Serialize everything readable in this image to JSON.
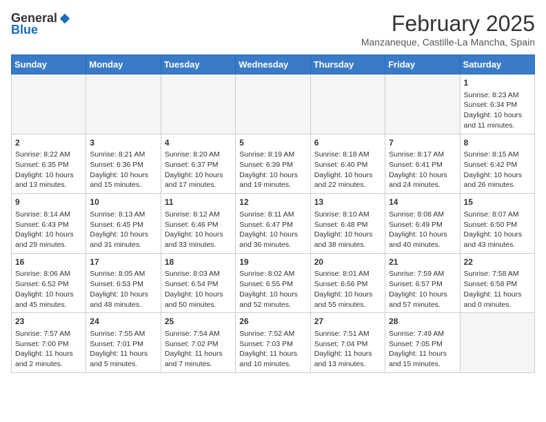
{
  "header": {
    "logo_general": "General",
    "logo_blue": "Blue",
    "month_year": "February 2025",
    "location": "Manzaneque, Castille-La Mancha, Spain"
  },
  "weekdays": [
    "Sunday",
    "Monday",
    "Tuesday",
    "Wednesday",
    "Thursday",
    "Friday",
    "Saturday"
  ],
  "weeks": [
    [
      {
        "day": "",
        "info": ""
      },
      {
        "day": "",
        "info": ""
      },
      {
        "day": "",
        "info": ""
      },
      {
        "day": "",
        "info": ""
      },
      {
        "day": "",
        "info": ""
      },
      {
        "day": "",
        "info": ""
      },
      {
        "day": "1",
        "info": "Sunrise: 8:23 AM\nSunset: 6:34 PM\nDaylight: 10 hours\nand 11 minutes."
      }
    ],
    [
      {
        "day": "2",
        "info": "Sunrise: 8:22 AM\nSunset: 6:35 PM\nDaylight: 10 hours\nand 13 minutes."
      },
      {
        "day": "3",
        "info": "Sunrise: 8:21 AM\nSunset: 6:36 PM\nDaylight: 10 hours\nand 15 minutes."
      },
      {
        "day": "4",
        "info": "Sunrise: 8:20 AM\nSunset: 6:37 PM\nDaylight: 10 hours\nand 17 minutes."
      },
      {
        "day": "5",
        "info": "Sunrise: 8:19 AM\nSunset: 6:39 PM\nDaylight: 10 hours\nand 19 minutes."
      },
      {
        "day": "6",
        "info": "Sunrise: 8:18 AM\nSunset: 6:40 PM\nDaylight: 10 hours\nand 22 minutes."
      },
      {
        "day": "7",
        "info": "Sunrise: 8:17 AM\nSunset: 6:41 PM\nDaylight: 10 hours\nand 24 minutes."
      },
      {
        "day": "8",
        "info": "Sunrise: 8:15 AM\nSunset: 6:42 PM\nDaylight: 10 hours\nand 26 minutes."
      }
    ],
    [
      {
        "day": "9",
        "info": "Sunrise: 8:14 AM\nSunset: 6:43 PM\nDaylight: 10 hours\nand 29 minutes."
      },
      {
        "day": "10",
        "info": "Sunrise: 8:13 AM\nSunset: 6:45 PM\nDaylight: 10 hours\nand 31 minutes."
      },
      {
        "day": "11",
        "info": "Sunrise: 8:12 AM\nSunset: 6:46 PM\nDaylight: 10 hours\nand 33 minutes."
      },
      {
        "day": "12",
        "info": "Sunrise: 8:11 AM\nSunset: 6:47 PM\nDaylight: 10 hours\nand 36 minutes."
      },
      {
        "day": "13",
        "info": "Sunrise: 8:10 AM\nSunset: 6:48 PM\nDaylight: 10 hours\nand 38 minutes."
      },
      {
        "day": "14",
        "info": "Sunrise: 8:08 AM\nSunset: 6:49 PM\nDaylight: 10 hours\nand 40 minutes."
      },
      {
        "day": "15",
        "info": "Sunrise: 8:07 AM\nSunset: 6:50 PM\nDaylight: 10 hours\nand 43 minutes."
      }
    ],
    [
      {
        "day": "16",
        "info": "Sunrise: 8:06 AM\nSunset: 6:52 PM\nDaylight: 10 hours\nand 45 minutes."
      },
      {
        "day": "17",
        "info": "Sunrise: 8:05 AM\nSunset: 6:53 PM\nDaylight: 10 hours\nand 48 minutes."
      },
      {
        "day": "18",
        "info": "Sunrise: 8:03 AM\nSunset: 6:54 PM\nDaylight: 10 hours\nand 50 minutes."
      },
      {
        "day": "19",
        "info": "Sunrise: 8:02 AM\nSunset: 6:55 PM\nDaylight: 10 hours\nand 52 minutes."
      },
      {
        "day": "20",
        "info": "Sunrise: 8:01 AM\nSunset: 6:56 PM\nDaylight: 10 hours\nand 55 minutes."
      },
      {
        "day": "21",
        "info": "Sunrise: 7:59 AM\nSunset: 6:57 PM\nDaylight: 10 hours\nand 57 minutes."
      },
      {
        "day": "22",
        "info": "Sunrise: 7:58 AM\nSunset: 6:58 PM\nDaylight: 11 hours\nand 0 minutes."
      }
    ],
    [
      {
        "day": "23",
        "info": "Sunrise: 7:57 AM\nSunset: 7:00 PM\nDaylight: 11 hours\nand 2 minutes."
      },
      {
        "day": "24",
        "info": "Sunrise: 7:55 AM\nSunset: 7:01 PM\nDaylight: 11 hours\nand 5 minutes."
      },
      {
        "day": "25",
        "info": "Sunrise: 7:54 AM\nSunset: 7:02 PM\nDaylight: 11 hours\nand 7 minutes."
      },
      {
        "day": "26",
        "info": "Sunrise: 7:52 AM\nSunset: 7:03 PM\nDaylight: 11 hours\nand 10 minutes."
      },
      {
        "day": "27",
        "info": "Sunrise: 7:51 AM\nSunset: 7:04 PM\nDaylight: 11 hours\nand 13 minutes."
      },
      {
        "day": "28",
        "info": "Sunrise: 7:49 AM\nSunset: 7:05 PM\nDaylight: 11 hours\nand 15 minutes."
      },
      {
        "day": "",
        "info": ""
      }
    ]
  ]
}
